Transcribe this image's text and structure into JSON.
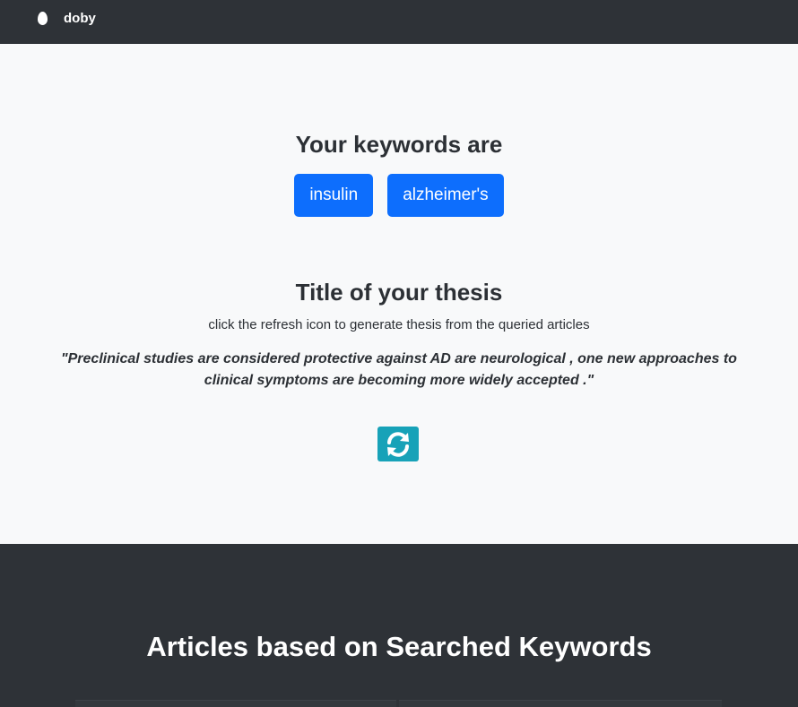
{
  "navbar": {
    "brand": "doby",
    "brand_icon": "egg-icon"
  },
  "keywords": {
    "heading": "Your keywords are",
    "items": [
      "insulin",
      "alzheimer's"
    ],
    "button_color": "#0d6efd"
  },
  "thesis": {
    "heading": "Title of your thesis",
    "hint": "click the refresh icon to generate thesis from the queried articles",
    "text": "\"Preclinical studies are considered protective against AD are neurological , one new approaches to clinical symptoms are becoming more widely accepted .\"",
    "refresh_icon": "refresh-icon",
    "refresh_color": "#17a2b8"
  },
  "articles": {
    "heading": "Articles based on Searched Keywords"
  }
}
